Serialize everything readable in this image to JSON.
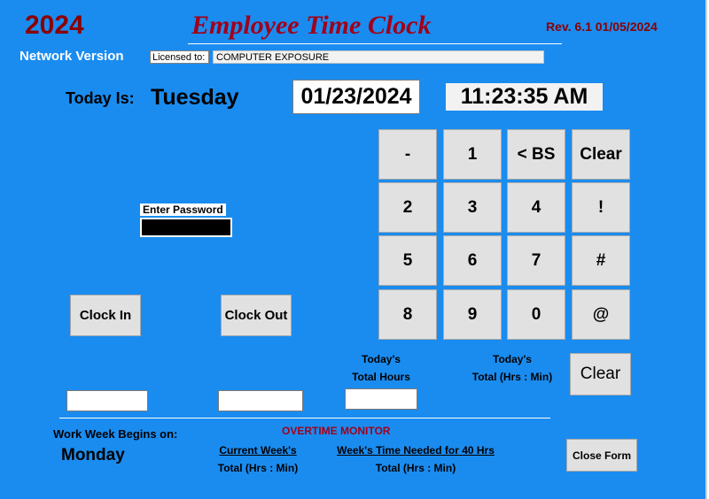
{
  "header": {
    "year": "2024",
    "title": "Employee Time Clock",
    "revision": "Rev. 6.1 01/05/2024",
    "network_version": "Network Version",
    "licensed_label": "Licensed to:",
    "licensed_value": "COMPUTER EXPOSURE"
  },
  "today": {
    "label": "Today Is:",
    "day": "Tuesday",
    "date": "01/23/2024",
    "time": "11:23:35 AM"
  },
  "keypad": {
    "keys": [
      "-",
      "1",
      "< BS",
      "Clear",
      "2",
      "3",
      "4",
      "!",
      "5",
      "6",
      "7",
      "#",
      "8",
      "9",
      "0",
      "@"
    ]
  },
  "password": {
    "label": "Enter Password",
    "value": ""
  },
  "actions": {
    "clock_in": "Clock In",
    "clock_out": "Clock Out",
    "clear": "Clear",
    "close_form": "Close Form"
  },
  "totals": {
    "todays_total_hours_line1": "Today's",
    "todays_total_hours_line2": "Total Hours",
    "todays_total_hm_line1": "Today's",
    "todays_total_hm_line2": "Total (Hrs : Min)",
    "clock_in_value": "",
    "clock_out_value": "",
    "todays_hours_value": ""
  },
  "workweek": {
    "label": "Work Week Begins on:",
    "day": "Monday"
  },
  "overtime": {
    "title": "OVERTIME MONITOR",
    "current_week_line1": "Current Week's",
    "current_week_line2": "Total (Hrs : Min)",
    "needed_line1": "Week's Time Needed for 40 Hrs",
    "needed_line2": "Total (Hrs : Min)"
  },
  "colors": {
    "background": "#1a8cf0",
    "accent": "#8b0000",
    "title": "#a0001a"
  }
}
